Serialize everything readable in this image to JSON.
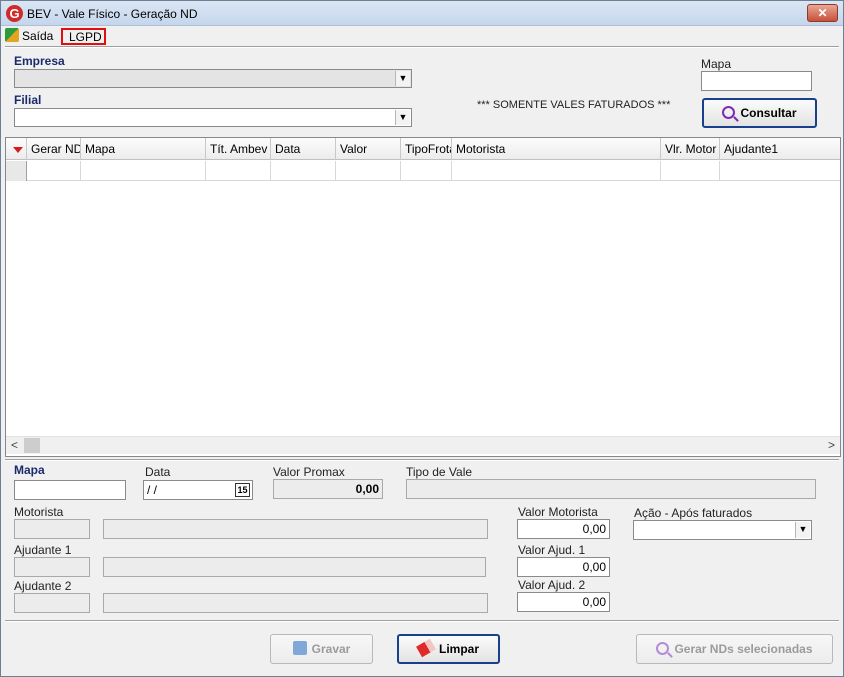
{
  "window": {
    "title": "BEV - Vale Físico - Geração ND",
    "close_glyph": "✕"
  },
  "menu": {
    "items": [
      {
        "label": "Saída",
        "icon": "exit-icon"
      },
      {
        "label": "LGPD"
      }
    ]
  },
  "filter": {
    "empresa_label": "Empresa",
    "empresa_value": "",
    "filial_label": "Filial",
    "filial_value": "",
    "notice": "*** SOMENTE VALES FATURADOS ***",
    "mapa_label": "Mapa",
    "mapa_value": "",
    "consultar_label": "Consultar"
  },
  "grid": {
    "columns": [
      "Gerar ND",
      "Mapa",
      "Tít. Ambev",
      "Data",
      "Valor",
      "TipoFrota",
      "Motorista",
      "Vlr. Motor",
      "Ajudante1"
    ],
    "rows": [
      [
        "",
        "",
        "",
        "",
        "",
        "",
        "",
        "",
        ""
      ]
    ]
  },
  "detail": {
    "mapa_label": "Mapa",
    "mapa_value": "",
    "data_label": "Data",
    "data_value": "/ /",
    "calendar_glyph": "15",
    "valor_promax_label": "Valor Promax",
    "valor_promax_value": "0,00",
    "tipo_vale_label": "Tipo de Vale",
    "tipo_vale_value": "",
    "motorista_label": "Motorista",
    "ajudante1_label": "Ajudante 1",
    "ajudante2_label": "Ajudante 2",
    "valor_motorista_label": "Valor Motorista",
    "valor_motorista_value": "0,00",
    "valor_ajud1_label": "Valor Ajud. 1",
    "valor_ajud1_value": "0,00",
    "valor_ajud2_label": "Valor Ajud. 2",
    "valor_ajud2_value": "0,00",
    "acao_label": "Ação - Após faturados",
    "acao_value": ""
  },
  "footer": {
    "gravar_label": "Gravar",
    "limpar_label": "Limpar",
    "gerar_label": "Gerar NDs selecionadas"
  }
}
